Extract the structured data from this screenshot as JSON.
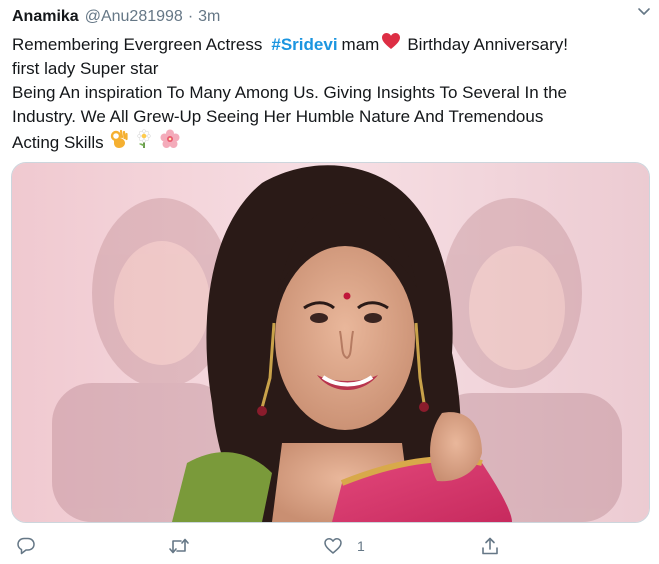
{
  "tweet": {
    "author_name": "Anamika",
    "handle": "@Anu281998",
    "separator": "·",
    "time": "3m",
    "text": {
      "line1_prefix": "Remembering Evergreen Actress",
      "hashtag": "#Sridevi",
      "line1_mid": "mam",
      "line1_suffix": "Birthday Anniversary!",
      "line2": "first lady Super star",
      "line3": "Being An inspiration To Many Among Us. Giving Insights To Several In the",
      "line4": "Industry. We All Grew-Up Seeing Her Humble Nature And Tremendous",
      "line5": "Acting Skills"
    },
    "emojis": [
      "red-heart",
      "ok-hand",
      "daisy",
      "cherry-blossom"
    ],
    "media": {
      "type": "photo",
      "description_icon": "image"
    },
    "actions": {
      "reply_icon": "comment-icon",
      "retweet_icon": "retweet-icon",
      "like_icon": "heart-icon",
      "like_count": "1",
      "share_icon": "share-icon"
    }
  },
  "colors": {
    "text": "#14171a",
    "secondary": "#657786",
    "hashtag": "#1b95e0",
    "heart": "#e0245e",
    "border": "#ccd6dd"
  }
}
